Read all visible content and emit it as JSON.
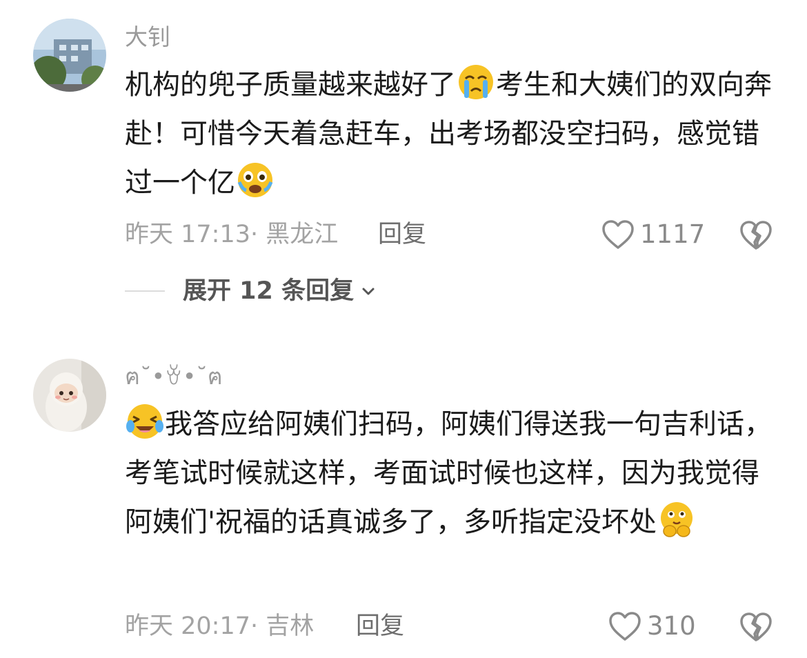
{
  "comments": [
    {
      "username": "大钊",
      "text_parts": [
        "机构的兜子质量越来越好了",
        "考生和大姨们的双向奔赴！可惜今天着急赶车，出考场都没空扫码，感觉错过一个亿"
      ],
      "emojis": [
        "crying-face-emoji",
        "sobbing-face-emoji"
      ],
      "time": "昨天 17:13",
      "location": "黑龙江",
      "reply_label": "回复",
      "likes": "1117",
      "expand_label": "展开 12 条回复"
    },
    {
      "username": "ฅ˘•ꈊ•˘ฅ",
      "text_parts": [
        "我答应给阿姨们扫码，阿姨们得送我一句吉利话，考笔试时候就这样，考面试时候也这样，因为我觉得阿姨们'祝福的话真诚多了，多听指定没坏处"
      ],
      "emojis": [
        "laughing-tears-emoji",
        "thinking-hands-emoji"
      ],
      "time": "昨天 20:17",
      "location": "吉林",
      "reply_label": "回复",
      "likes": "310"
    }
  ],
  "colors": {
    "muted": "#a3a3a3",
    "text": "#1b1b1b",
    "emoji": "#f7c325"
  }
}
